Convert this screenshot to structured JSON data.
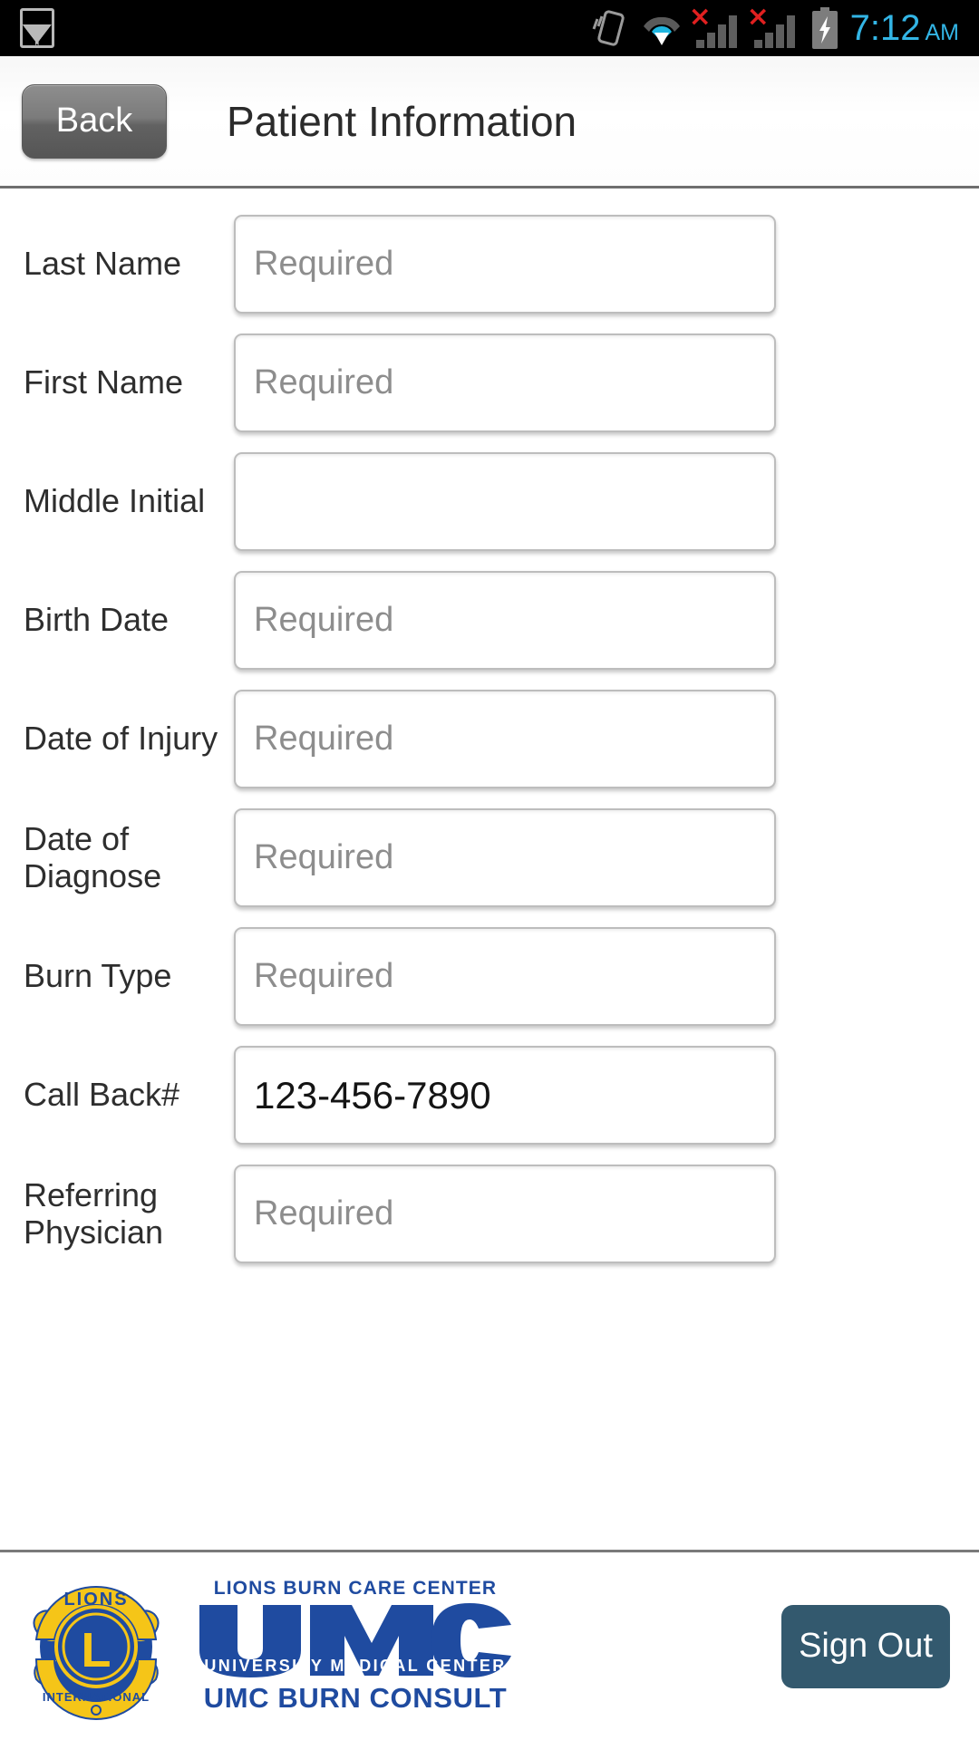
{
  "statusbar": {
    "time": "7:12",
    "ampm": "AM",
    "icons": [
      "gallery-icon",
      "vibrate-icon",
      "wifi-icon",
      "signal-no-service-icon-1",
      "signal-no-service-icon-2",
      "battery-charging-icon"
    ],
    "no_service_mark": "×",
    "clock_color": "#33b5e5"
  },
  "header": {
    "back_label": "Back",
    "title": "Patient Information"
  },
  "form": {
    "fields": [
      {
        "label": "Last Name",
        "value": "",
        "placeholder": "Required"
      },
      {
        "label": "First Name",
        "value": "",
        "placeholder": "Required"
      },
      {
        "label": "Middle Initial",
        "value": "",
        "placeholder": ""
      },
      {
        "label": "Birth Date",
        "value": "",
        "placeholder": "Required"
      },
      {
        "label": "Date of Injury",
        "value": "",
        "placeholder": "Required"
      },
      {
        "label": "Date of Diagnose",
        "value": "",
        "placeholder": "Required"
      },
      {
        "label": "Burn Type",
        "value": "",
        "placeholder": "Required"
      },
      {
        "label": "Call Back#",
        "value": "123-456-7890",
        "placeholder": ""
      },
      {
        "label": "Referring Physician",
        "value": "",
        "placeholder": "Required"
      }
    ]
  },
  "footer": {
    "lions_logo": {
      "name": "lions-international-logo",
      "top_text": "LIONS",
      "center_letter": "L",
      "bottom_text": "INTERNATIONAL",
      "blue": "#1f4ba0",
      "gold": "#f5c518"
    },
    "umc_logo": {
      "name": "umc-burn-consult-logo",
      "top_line": "LIONS BURN CARE CENTER",
      "wordmark": "UMC",
      "sub_line": "UNIVERSITY MEDICAL CENTER",
      "bottom_line": "UMC BURN CONSULT",
      "blue": "#1f4ba0"
    },
    "signout_label": "Sign Out",
    "signout_color": "#33596e"
  }
}
